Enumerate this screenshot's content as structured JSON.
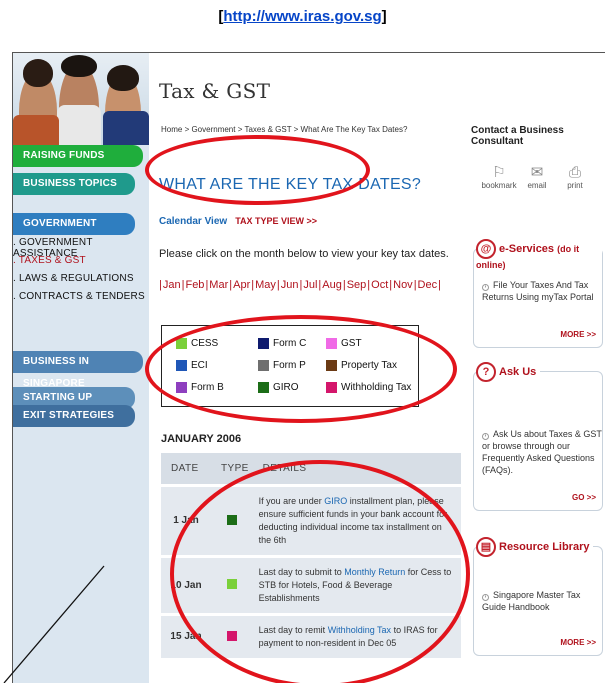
{
  "caption": {
    "url": "http://www.iras.gov.sg",
    "open": "[",
    "close": "]"
  },
  "sidebar": {
    "raising_funds": "RAISING FUNDS",
    "business_topics": "BUSINESS TOPICS",
    "government": "GOVERNMENT",
    "sub_items": [
      "GOVERNMENT ASSISTANCE",
      "TAXES & GST",
      "LAWS & REGULATIONS",
      "CONTRACTS & TENDERS"
    ],
    "business_in_singapore": "BUSINESS IN SINGAPORE",
    "starting_up": "STARTING UP",
    "exit_strategies": "EXIT STRATEGIES"
  },
  "main": {
    "page_title": "Tax & GST",
    "breadcrumb": "Home > Government > Taxes & GST > What Are The Key Tax Dates?",
    "heading": "WHAT ARE THE KEY TAX DATES?",
    "calendar_view": "Calendar View",
    "tax_type_view": "TAX TYPE VIEW >>",
    "instruction": "Please click on the month below to view your key tax dates.",
    "months": [
      "Jan",
      "Feb",
      "Mar",
      "Apr",
      "May",
      "Jun",
      "Jul",
      "Aug",
      "Sep",
      "Oct",
      "Nov",
      "Dec"
    ],
    "legend": [
      {
        "label": "CESS",
        "color": "#7ad03a"
      },
      {
        "label": "Form C",
        "color": "#0e1a6e"
      },
      {
        "label": "GST",
        "color": "#f06ae6"
      },
      {
        "label": "ECI",
        "color": "#1f57b7"
      },
      {
        "label": "Form P",
        "color": "#6f6f6f"
      },
      {
        "label": "Property Tax",
        "color": "#6b3a14"
      },
      {
        "label": "Form B",
        "color": "#8e3fbf"
      },
      {
        "label": "GIRO",
        "color": "#1c6d17"
      },
      {
        "label": "Withholding Tax",
        "color": "#d4166b"
      }
    ],
    "month_label": "JANUARY 2006",
    "table": {
      "headers": [
        "DATE",
        "TYPE",
        "DETAILS"
      ],
      "rows": [
        {
          "date": "1 Jan",
          "color": "#1c6d17",
          "pre": "If you are under ",
          "link": "GIRO",
          "post": " installment plan, please ensure sufficient funds in your bank account for deducting individual income tax installment on the 6th"
        },
        {
          "date": "10 Jan",
          "color": "#7ad03a",
          "pre": "Last day to submit to ",
          "link": "Monthly Return",
          "post": " for Cess to STB for Hotels, Food & Beverage Establishments"
        },
        {
          "date": "15 Jan",
          "color": "#d4166b",
          "pre": "Last day to remit ",
          "link": "Withholding Tax",
          "post": " to IRAS for payment to non-resident in Dec 05"
        }
      ]
    }
  },
  "right": {
    "contact": "Contact a Business Consultant",
    "icons": [
      {
        "icon": "bookmark-icon",
        "label": "bookmark"
      },
      {
        "icon": "email-icon",
        "label": "email"
      },
      {
        "icon": "print-icon",
        "label": "print"
      }
    ],
    "eservices": {
      "title": "e-Services",
      "sub": "(do it online)",
      "text": "File Your Taxes And Tax Returns Using myTax Portal",
      "more": "MORE >>"
    },
    "ask_us": {
      "title": "Ask Us",
      "text": "Ask Us about Taxes & GST or browse through our Frequently Asked Questions (FAQs).",
      "more": "GO >>"
    },
    "resource": {
      "title": "Resource Library",
      "text": "Singapore Master Tax Guide Handbook",
      "more": "MORE >>"
    }
  }
}
